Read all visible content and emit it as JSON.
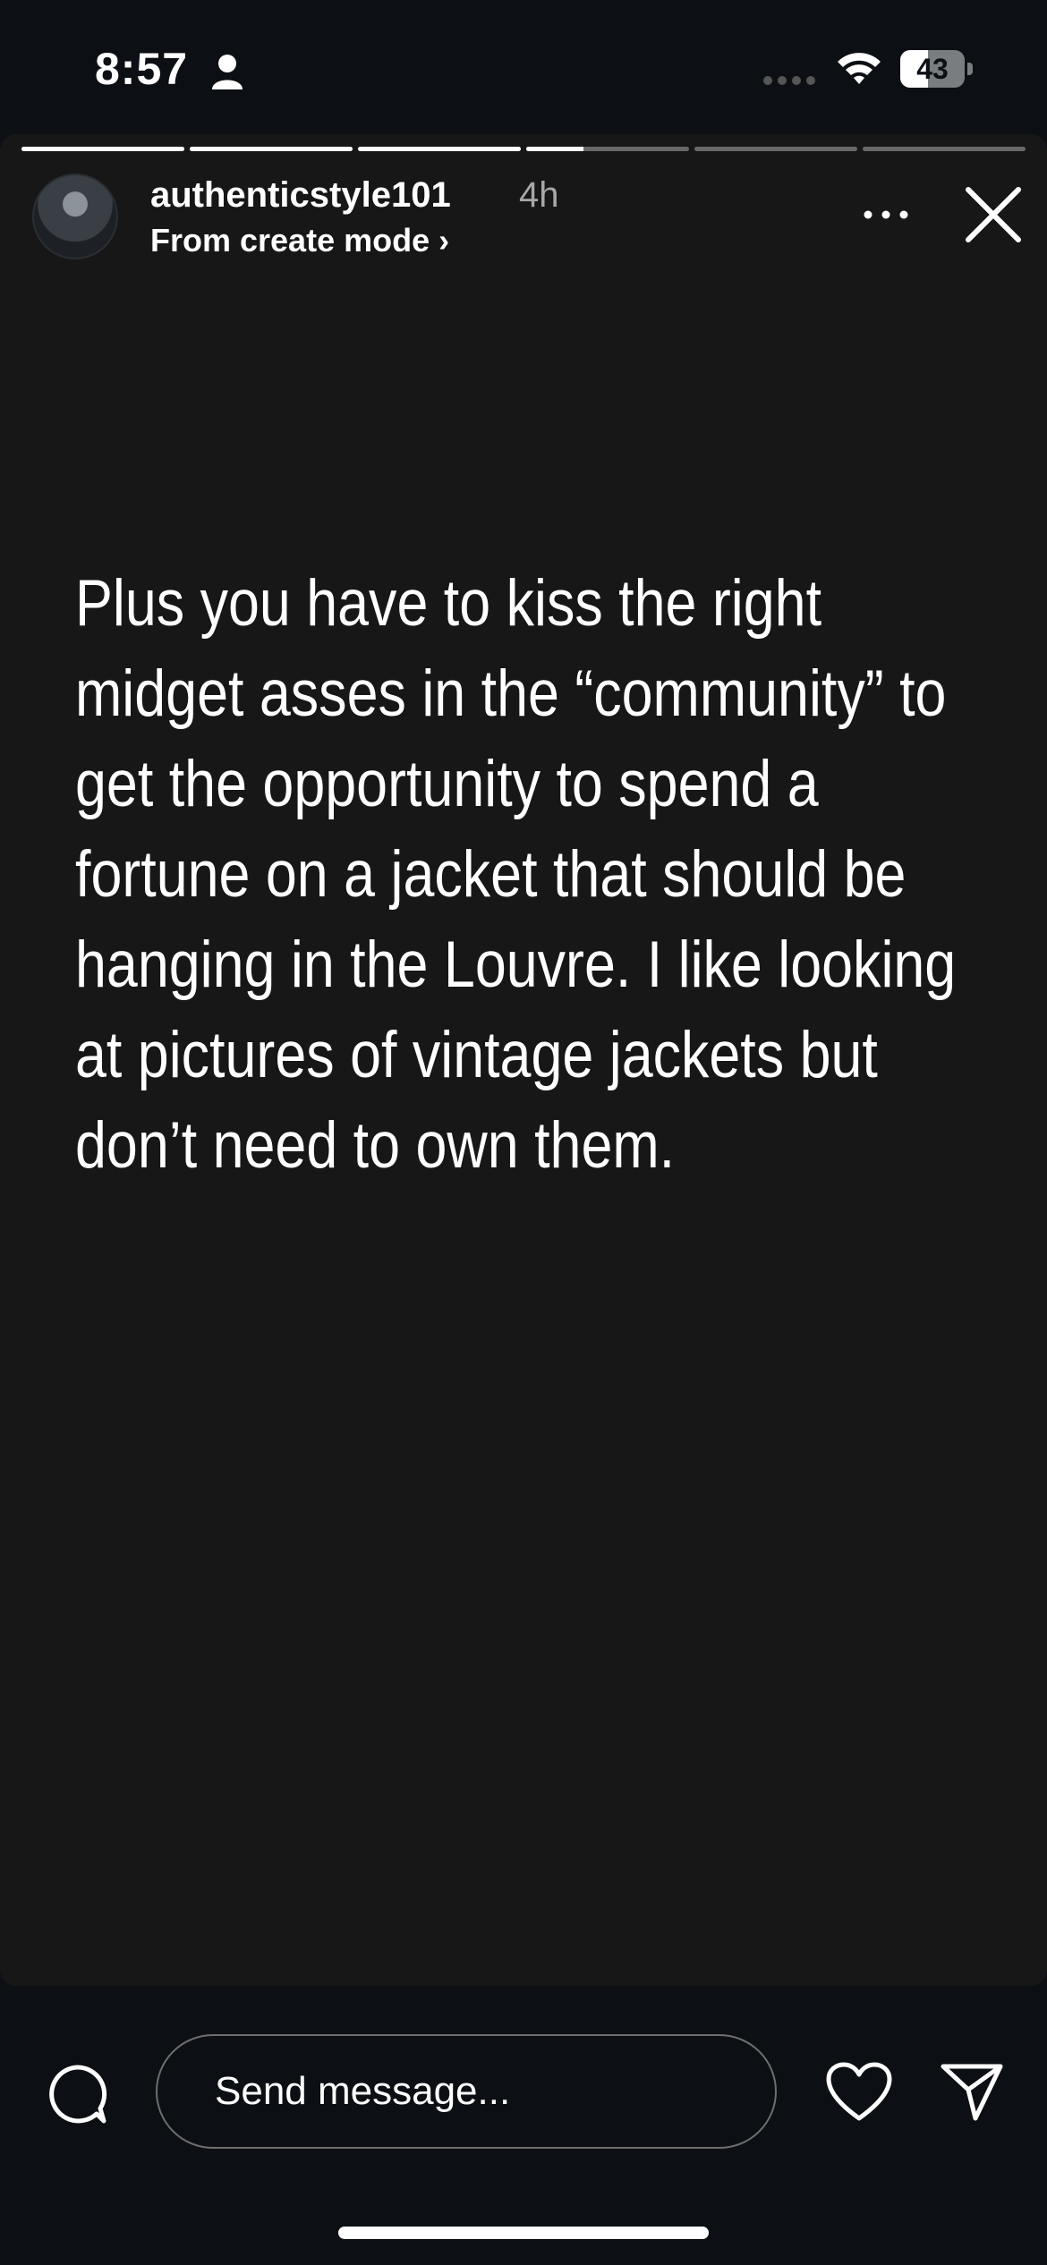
{
  "status_bar": {
    "time": "8:57",
    "battery": "43",
    "battery_level": 0.43,
    "icons": [
      "person-icon",
      "signal-icon",
      "wifi-icon",
      "battery-icon"
    ]
  },
  "story": {
    "progress": [
      1,
      1,
      1,
      0.35,
      0,
      0
    ],
    "username": "authenticstyle101",
    "time_ago": "4h",
    "subtitle": "From create mode ›",
    "text": "Plus you have to kiss the right midget asses in the “community” to get the opportunity to spend a fortune on a jacket that should be hanging in the Louvre. I like looking at pictures of vintage jackets but don’t need to own them.",
    "icons": [
      "more-icon",
      "close-icon"
    ]
  },
  "footer": {
    "message_placeholder": "Send message...",
    "icons": [
      "chat-icon",
      "heart-icon",
      "send-icon"
    ]
  },
  "colors": {
    "background": "#0c1014",
    "story_background": "#171717",
    "text": "#ffffff",
    "secondary_text": "#a8a8a8"
  }
}
